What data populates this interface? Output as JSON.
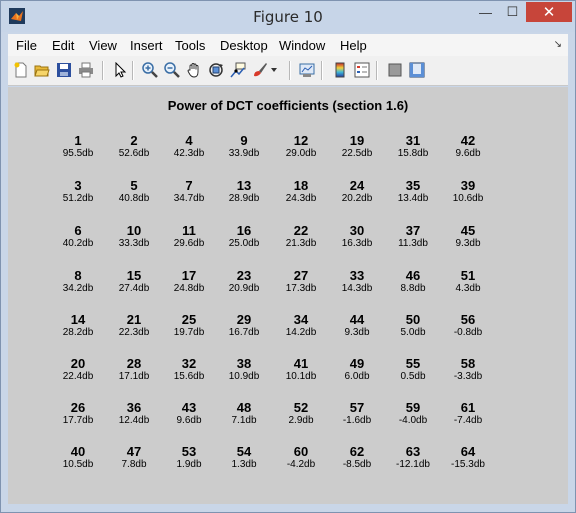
{
  "window": {
    "title": "Figure 10",
    "controls": {
      "minimize": "—",
      "maximize": "☐",
      "close": "✕"
    }
  },
  "menubar": {
    "items": [
      "File",
      "Edit",
      "View",
      "Insert",
      "Tools",
      "Desktop",
      "Window",
      "Help"
    ],
    "overflow_arrow": "↘"
  },
  "toolbar": {
    "icons": [
      "new-figure-icon",
      "open-file-icon",
      "save-icon",
      "print-icon",
      "select-arrow-icon",
      "zoom-in-icon",
      "zoom-out-icon",
      "pan-hand-icon",
      "rotate-3d-icon",
      "data-cursor-icon",
      "brush-icon",
      "link-plot-icon",
      "colorbar-icon",
      "legend-icon",
      "hide-plot-tools-icon",
      "show-plot-tools-icon"
    ]
  },
  "figure": {
    "title": "Power of DCT coefficients (section 1.6)",
    "grid": [
      [
        {
          "idx": "1",
          "pw": "95.5db"
        },
        {
          "idx": "2",
          "pw": "52.6db"
        },
        {
          "idx": "4",
          "pw": "42.3db"
        },
        {
          "idx": "9",
          "pw": "33.9db"
        },
        {
          "idx": "12",
          "pw": "29.0db"
        },
        {
          "idx": "19",
          "pw": "22.5db"
        },
        {
          "idx": "31",
          "pw": "15.8db"
        },
        {
          "idx": "42",
          "pw": "9.6db"
        }
      ],
      [
        {
          "idx": "3",
          "pw": "51.2db"
        },
        {
          "idx": "5",
          "pw": "40.8db"
        },
        {
          "idx": "7",
          "pw": "34.7db"
        },
        {
          "idx": "13",
          "pw": "28.9db"
        },
        {
          "idx": "18",
          "pw": "24.3db"
        },
        {
          "idx": "24",
          "pw": "20.2db"
        },
        {
          "idx": "35",
          "pw": "13.4db"
        },
        {
          "idx": "39",
          "pw": "10.6db"
        }
      ],
      [
        {
          "idx": "6",
          "pw": "40.2db"
        },
        {
          "idx": "10",
          "pw": "33.3db"
        },
        {
          "idx": "11",
          "pw": "29.6db"
        },
        {
          "idx": "16",
          "pw": "25.0db"
        },
        {
          "idx": "22",
          "pw": "21.3db"
        },
        {
          "idx": "30",
          "pw": "16.3db"
        },
        {
          "idx": "37",
          "pw": "11.3db"
        },
        {
          "idx": "45",
          "pw": "9.3db"
        }
      ],
      [
        {
          "idx": "8",
          "pw": "34.2db"
        },
        {
          "idx": "15",
          "pw": "27.4db"
        },
        {
          "idx": "17",
          "pw": "24.8db"
        },
        {
          "idx": "23",
          "pw": "20.9db"
        },
        {
          "idx": "27",
          "pw": "17.3db"
        },
        {
          "idx": "33",
          "pw": "14.3db"
        },
        {
          "idx": "46",
          "pw": "8.8db"
        },
        {
          "idx": "51",
          "pw": "4.3db"
        }
      ],
      [
        {
          "idx": "14",
          "pw": "28.2db"
        },
        {
          "idx": "21",
          "pw": "22.3db"
        },
        {
          "idx": "25",
          "pw": "19.7db"
        },
        {
          "idx": "29",
          "pw": "16.7db"
        },
        {
          "idx": "34",
          "pw": "14.2db"
        },
        {
          "idx": "44",
          "pw": "9.3db"
        },
        {
          "idx": "50",
          "pw": "5.0db"
        },
        {
          "idx": "56",
          "pw": "-0.8db"
        }
      ],
      [
        {
          "idx": "20",
          "pw": "22.4db"
        },
        {
          "idx": "28",
          "pw": "17.1db"
        },
        {
          "idx": "32",
          "pw": "15.6db"
        },
        {
          "idx": "38",
          "pw": "10.9db"
        },
        {
          "idx": "41",
          "pw": "10.1db"
        },
        {
          "idx": "49",
          "pw": "6.0db"
        },
        {
          "idx": "55",
          "pw": "0.5db"
        },
        {
          "idx": "58",
          "pw": "-3.3db"
        }
      ],
      [
        {
          "idx": "26",
          "pw": "17.7db"
        },
        {
          "idx": "36",
          "pw": "12.4db"
        },
        {
          "idx": "43",
          "pw": "9.6db"
        },
        {
          "idx": "48",
          "pw": "7.1db"
        },
        {
          "idx": "52",
          "pw": "2.9db"
        },
        {
          "idx": "57",
          "pw": "-1.6db"
        },
        {
          "idx": "59",
          "pw": "-4.0db"
        },
        {
          "idx": "61",
          "pw": "-7.4db"
        }
      ],
      [
        {
          "idx": "40",
          "pw": "10.5db"
        },
        {
          "idx": "47",
          "pw": "7.8db"
        },
        {
          "idx": "53",
          "pw": "1.9db"
        },
        {
          "idx": "54",
          "pw": "1.3db"
        },
        {
          "idx": "60",
          "pw": "-4.2db"
        },
        {
          "idx": "62",
          "pw": "-8.5db"
        },
        {
          "idx": "63",
          "pw": "-12.1db"
        },
        {
          "idx": "64",
          "pw": "-15.3db"
        }
      ]
    ]
  },
  "colors": {
    "title_bar": "#c7d5e8",
    "close_button": "#c7453a",
    "figure_background": "#cccccc"
  }
}
